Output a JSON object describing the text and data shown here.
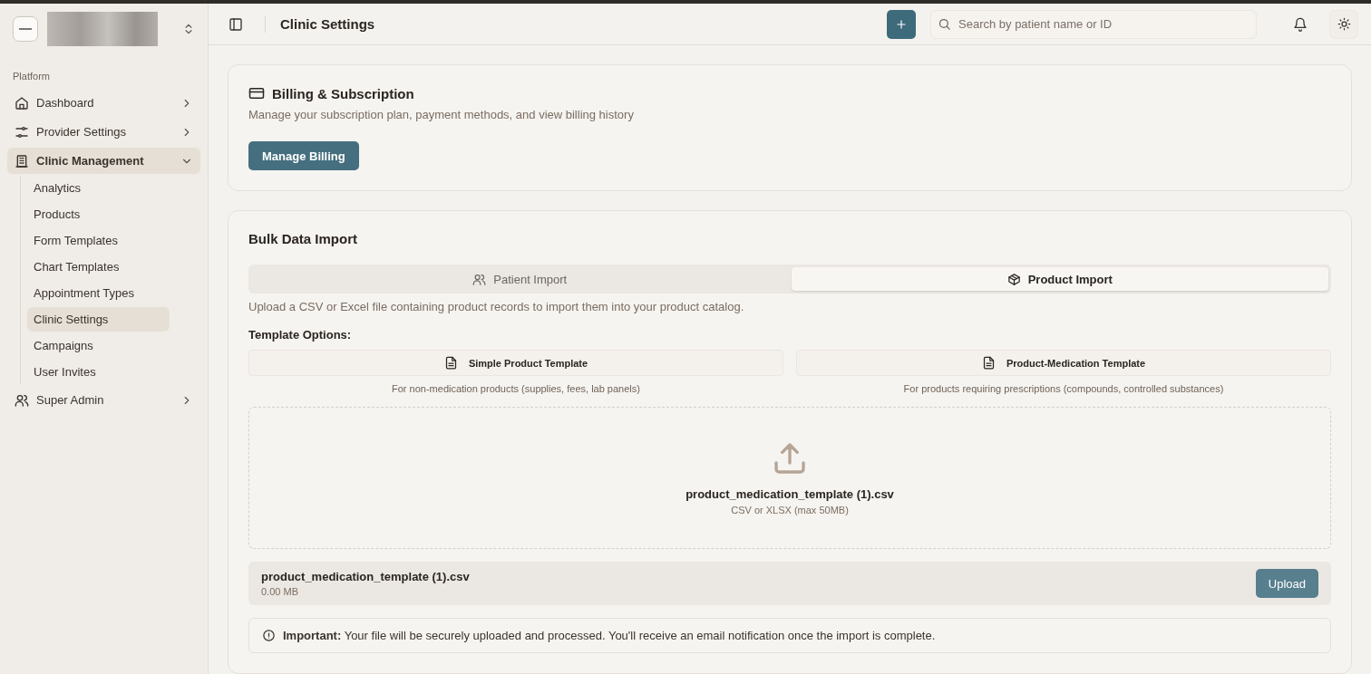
{
  "sidebar": {
    "section_label": "Platform",
    "items": [
      {
        "label": "Dashboard",
        "selected": false,
        "expanded": false
      },
      {
        "label": "Provider Settings",
        "selected": false,
        "expanded": false
      },
      {
        "label": "Clinic Management",
        "selected": true,
        "expanded": true,
        "children": [
          {
            "label": "Analytics",
            "selected": false
          },
          {
            "label": "Products",
            "selected": false
          },
          {
            "label": "Form Templates",
            "selected": false
          },
          {
            "label": "Chart Templates",
            "selected": false
          },
          {
            "label": "Appointment Types",
            "selected": false
          },
          {
            "label": "Clinic Settings",
            "selected": true
          },
          {
            "label": "Campaigns",
            "selected": false
          },
          {
            "label": "User Invites",
            "selected": false
          }
        ]
      },
      {
        "label": "Super Admin",
        "selected": false,
        "expanded": false
      }
    ]
  },
  "header": {
    "title": "Clinic Settings",
    "search": {
      "placeholder": "Search by patient name or ID"
    }
  },
  "billing": {
    "title": "Billing & Subscription",
    "description": "Manage your subscription plan, payment methods, and view billing history",
    "button": "Manage Billing"
  },
  "import": {
    "title": "Bulk Data Import",
    "tabs": [
      {
        "label": "Patient Import",
        "selected": false
      },
      {
        "label": "Product Import",
        "selected": true
      }
    ],
    "description": "Upload a CSV or Excel file containing product records to import them into your product catalog.",
    "template_heading": "Template Options:",
    "templates": [
      {
        "label": "Simple Product Template",
        "note": "For non-medication products (supplies, fees, lab panels)"
      },
      {
        "label": "Product-Medication Template",
        "note": "For products requiring prescriptions (compounds, controlled substances)"
      }
    ],
    "dropzone": {
      "file_name": "product_medication_template (1).csv",
      "hint": "CSV or XLSX (max 50MB)"
    },
    "file": {
      "name": "product_medication_template (1).csv",
      "size": "0.00 MB",
      "button": "Upload"
    },
    "notice": "**Important:** Your file will be securely uploaded and processed. You'll receive an email notification once the import is complete."
  }
}
